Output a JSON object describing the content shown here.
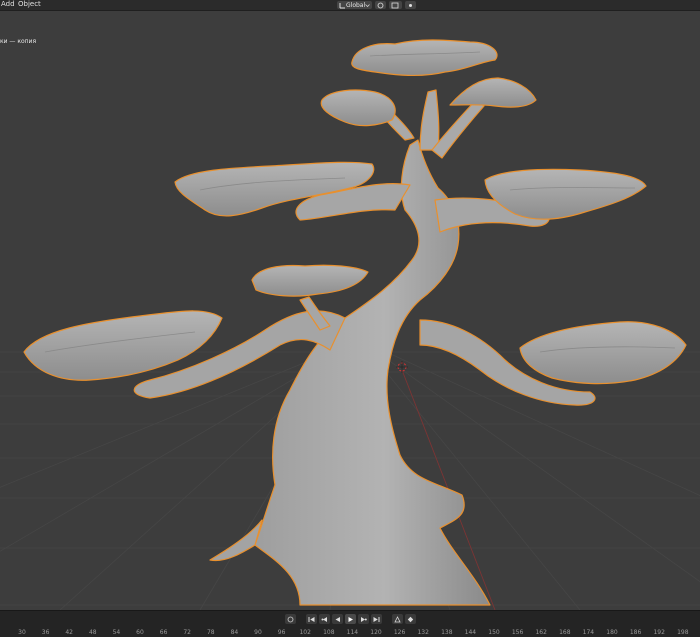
{
  "header": {
    "menus": [
      "Add",
      "Object"
    ],
    "orientation": "Global",
    "icons": [
      "transform-orientation-icon",
      "pivot-icon",
      "snap-icon",
      "snap-target-icon",
      "proportional-edit-icon"
    ]
  },
  "viewport": {
    "collection_label": "ки — копия",
    "selection_outline_color": "#e8902e",
    "grid_color": "#474747",
    "x_axis_color": "#8a3a3a",
    "object": "bonsai-tree-sculpt",
    "object_icon": "tree-model-icon"
  },
  "timeline": {
    "controls": [
      "jump-start-icon",
      "prev-keyframe-icon",
      "play-reverse-icon",
      "play-icon",
      "next-keyframe-icon",
      "jump-end-icon",
      "keying-icon",
      "auto-key-icon"
    ],
    "ruler_ticks": [
      "30",
      "36",
      "42",
      "48",
      "54",
      "60",
      "66",
      "72",
      "78",
      "84",
      "90",
      "96",
      "102",
      "108",
      "114",
      "120",
      "126",
      "132",
      "138",
      "144",
      "150",
      "156",
      "162",
      "168",
      "174",
      "180",
      "186",
      "192",
      "198"
    ],
    "current_frame": ""
  },
  "colors": {
    "header_bg": "#2b2b2b",
    "viewport_bg": "#3d3d3d",
    "timeline_bg": "#242424",
    "mesh": "#9a9a9a",
    "outline": "#e8902e"
  }
}
